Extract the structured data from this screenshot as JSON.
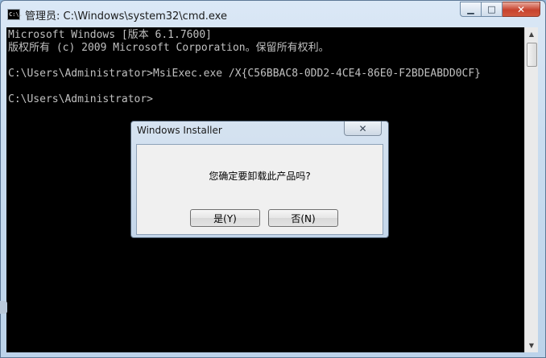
{
  "window": {
    "title": "管理员: C:\\Windows\\system32\\cmd.exe",
    "icon_text": "C:\\."
  },
  "controls": {
    "minimize": "▁",
    "maximize": "□",
    "close": "✕"
  },
  "console": {
    "lines": [
      "Microsoft Windows [版本 6.1.7600]",
      "版权所有 (c) 2009 Microsoft Corporation。保留所有权利。",
      "",
      "C:\\Users\\Administrator>MsiExec.exe /X{C56BBAC8-0DD2-4CE4-86E0-F2BDEABDD0CF}",
      "",
      "C:\\Users\\Administrator>"
    ]
  },
  "dialog": {
    "title": "Windows Installer",
    "close": "✕",
    "message": "您确定要卸载此产品吗?",
    "yes_label": "是(Y)",
    "no_label": "否(N)"
  },
  "scrollbar": {
    "up": "▲",
    "down": "▼"
  }
}
